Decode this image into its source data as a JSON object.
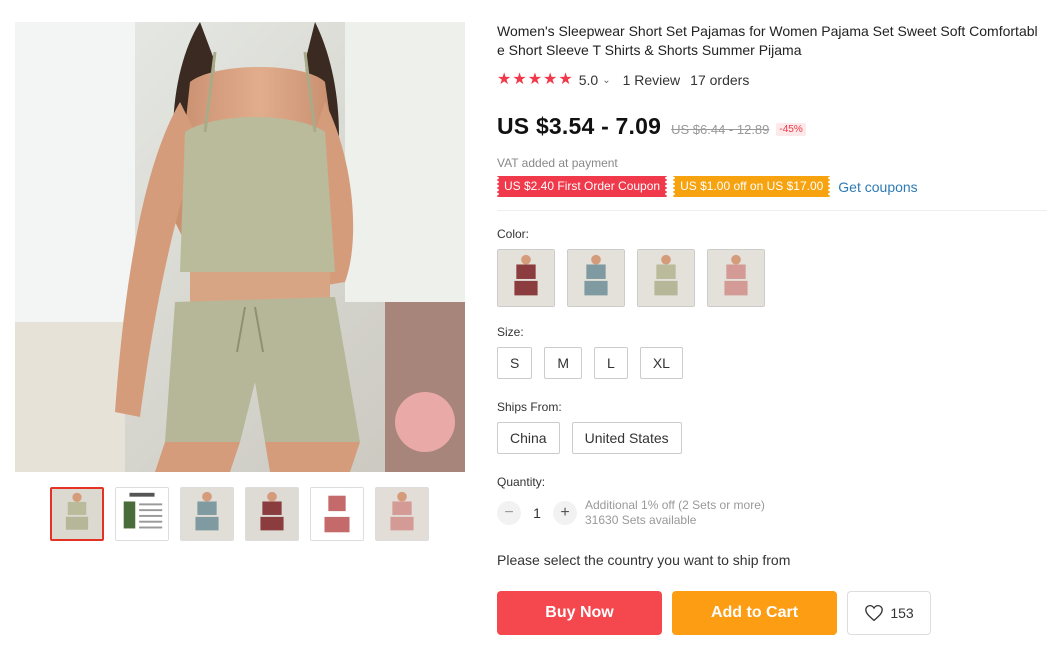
{
  "product": {
    "title": "Women's Sleepwear Short Set Pajamas for Women Pajama Set Sweet Soft Comfortable Short Sleeve T Shirts & Shorts Summer Pijama",
    "rating": {
      "stars": 5,
      "value": "5.0",
      "reviews": "1 Review",
      "orders": "17 orders"
    },
    "price": {
      "current": "US $3.54 - 7.09",
      "original": "US $6.44 - 12.89",
      "discount": "-45%",
      "vat_note": "VAT added at payment"
    },
    "coupons": [
      {
        "label": "US $2.40 First Order Coupon",
        "color": "#f0394a"
      },
      {
        "label": "US $1.00 off on US $17.00",
        "color": "#f7a20f"
      }
    ],
    "get_coupons": "Get coupons"
  },
  "gallery": {
    "main_image": "model-wearing-sage-green-ribbed-pajama-set",
    "thumbnails": [
      {
        "name": "sage-green",
        "active": true
      },
      {
        "name": "size-chart"
      },
      {
        "name": "blue-gray"
      },
      {
        "name": "burgundy"
      },
      {
        "name": "pink-flatlay"
      },
      {
        "name": "pink"
      }
    ]
  },
  "color": {
    "label": "Color:",
    "options": [
      {
        "name": "burgundy",
        "hex": "#8a3c3e"
      },
      {
        "name": "blue-gray",
        "hex": "#7f9aa0"
      },
      {
        "name": "sage-green",
        "hex": "#b9bb9a"
      },
      {
        "name": "pink",
        "hex": "#d49a96"
      }
    ]
  },
  "size": {
    "label": "Size:",
    "options": [
      "S",
      "M",
      "L",
      "XL"
    ]
  },
  "ships_from": {
    "label": "Ships From:",
    "options": [
      "China",
      "United States"
    ]
  },
  "quantity": {
    "label": "Quantity:",
    "minus": "−",
    "plus": "+",
    "value": "1",
    "discount_note": "Additional 1% off (2 Sets or more)",
    "available": "31630 Sets available"
  },
  "ship_message": "Please select the country you want to ship from",
  "actions": {
    "buy_now": "Buy Now",
    "add_to_cart": "Add to Cart",
    "wishlist_count": "153"
  },
  "colors": {
    "buy": "#f5474e",
    "cart": "#fc9d14",
    "accent": "#f0394a",
    "link": "#2e7bb5"
  }
}
